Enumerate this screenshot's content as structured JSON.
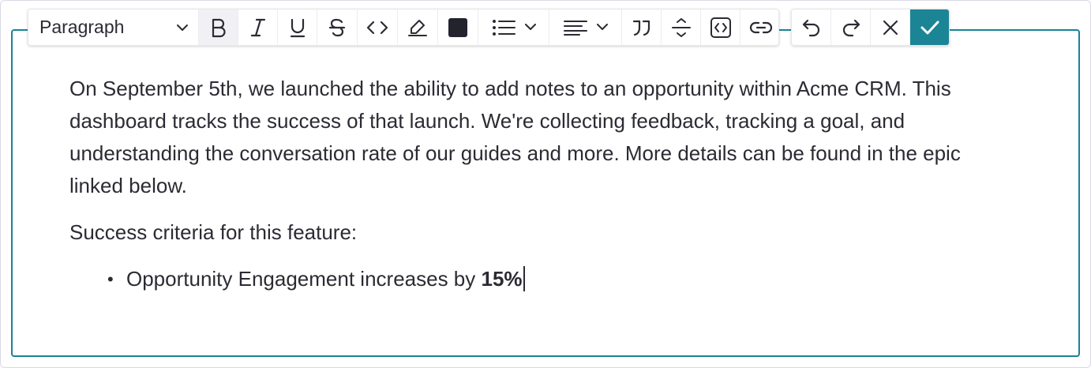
{
  "toolbar": {
    "block_format": "Paragraph",
    "text_color": "#23232e",
    "buttons": [
      "bold",
      "italic",
      "underline",
      "strikethrough",
      "inline-code",
      "highlight",
      "text-color",
      "bullet-list",
      "align",
      "blockquote",
      "horizontal-rule",
      "code-block",
      "link"
    ],
    "actions": [
      "undo",
      "redo",
      "cancel",
      "confirm"
    ]
  },
  "editor": {
    "paragraph1": "On September 5th, we launched the ability to add notes to an opportunity within Acme CRM. This dashboard tracks the success of that launch. We're collecting feedback, tracking a goal, and understanding the conversation rate of our guides and more. More details can be found in the epic linked below.",
    "paragraph2": "Success criteria for this feature:",
    "bullets": [
      {
        "text": "Opportunity Engagement increases by ",
        "bold": "15%"
      }
    ]
  },
  "colors": {
    "accent": "#1a8393",
    "confirm_bg": "#1b8596",
    "text": "#2b2b33"
  }
}
